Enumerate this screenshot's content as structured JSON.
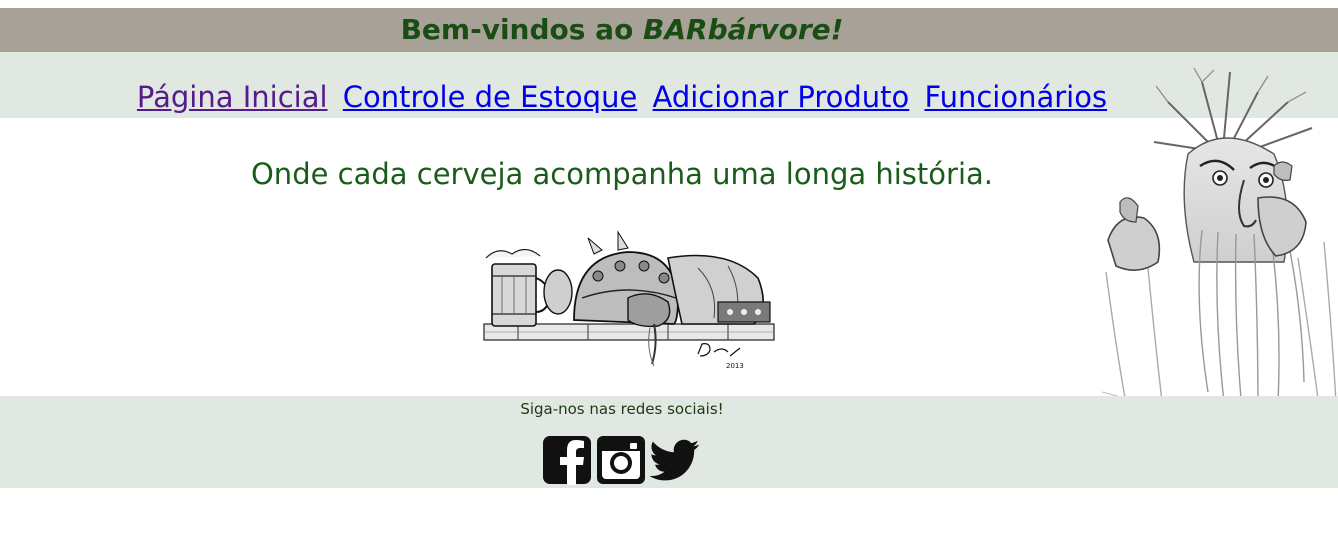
{
  "header": {
    "title_prefix": "Bem-vindos ao ",
    "title_brand": "BARbárvore!"
  },
  "nav": {
    "items": [
      {
        "label": "Página Inicial",
        "state": "visited"
      },
      {
        "label": "Controle de Estoque",
        "state": "link"
      },
      {
        "label": "Adicionar Produto",
        "state": "link"
      },
      {
        "label": "Funcionários",
        "state": "link"
      }
    ]
  },
  "main": {
    "tagline": "Onde cada cerveja acompanha uma longa história."
  },
  "footer": {
    "social_text": "Siga-nos nas redes sociais!",
    "icons": [
      "facebook-icon",
      "instagram-icon",
      "twitter-icon"
    ]
  },
  "colors": {
    "header_bg": "#a8a197",
    "nav_bg": "#e1e8e1",
    "title_green": "#1a4d14",
    "tagline_green": "#1a5c1a",
    "link_blue": "#0000ee",
    "link_visited": "#551a8b"
  }
}
